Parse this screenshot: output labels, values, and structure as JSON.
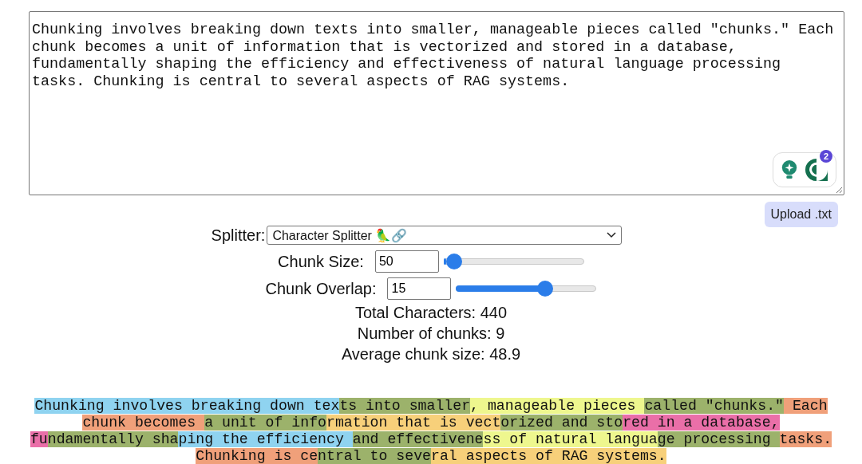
{
  "editor": {
    "value": "Chunking involves breaking down texts into smaller, manageable pieces called \"chunks.\" Each chunk becomes a unit of information that is vectorized and stored in a database, fundamentally shaping the efficiency and effectiveness of natural language processing tasks. Chunking is central to several aspects of RAG systems.",
    "grammarly_badge": "2"
  },
  "upload_button": "Upload .txt",
  "splitter": {
    "label": "Splitter:",
    "value": "Character Splitter 🦜🔗"
  },
  "settings": [
    {
      "label": "Chunk Size:",
      "value": "50",
      "level": 0.02
    },
    {
      "label": "Chunk Overlap:",
      "value": "15",
      "level": 0.65
    }
  ],
  "stats": [
    "Total Characters: 440",
    "Number of chunks: 9",
    "Average chunk size: 48.9"
  ],
  "chunk_lines": [
    {
      "segments": [
        {
          "text": "Chunking involves breaking down tex",
          "color": "#8fd3f0"
        },
        {
          "text": "ts into smaller",
          "color": "#9cb26b"
        },
        {
          "text": ", manageable pieces ",
          "color": "#eef78e"
        },
        {
          "text": "called \"chunks.\"",
          "color": "#9cb26b"
        },
        {
          "text": " Each",
          "color": "#f0a07a"
        }
      ]
    },
    {
      "segments": [
        {
          "text": "chunk becomes ",
          "color": "#f0a07a"
        },
        {
          "text": "a unit of info",
          "color": "#9cb26b"
        },
        {
          "text": "rmation that is vect",
          "color": "#f7d07a"
        },
        {
          "text": "orized and sto",
          "color": "#9cb26b"
        },
        {
          "text": "red in a database,",
          "color": "#ea6fa8"
        }
      ]
    },
    {
      "segments": [
        {
          "text": "fu",
          "color": "#ea6fa8"
        },
        {
          "text": "ndamentally sha",
          "color": "#9cb26b"
        },
        {
          "text": "ping the efficiency ",
          "color": "#8fd3f0"
        },
        {
          "text": "and effectivene",
          "color": "#9cb26b"
        },
        {
          "text": "ss of natural langua",
          "color": "#eef78e"
        },
        {
          "text": "ge processing ",
          "color": "#9cb26b"
        },
        {
          "text": "tasks.",
          "color": "#f0a07a"
        }
      ]
    },
    {
      "segments": [
        {
          "text": "Chunking is ce",
          "color": "#f0a07a"
        },
        {
          "text": "ntral to seve",
          "color": "#9cb26b"
        },
        {
          "text": "ral aspects of RAG systems.",
          "color": "#f7d07a"
        }
      ]
    }
  ]
}
